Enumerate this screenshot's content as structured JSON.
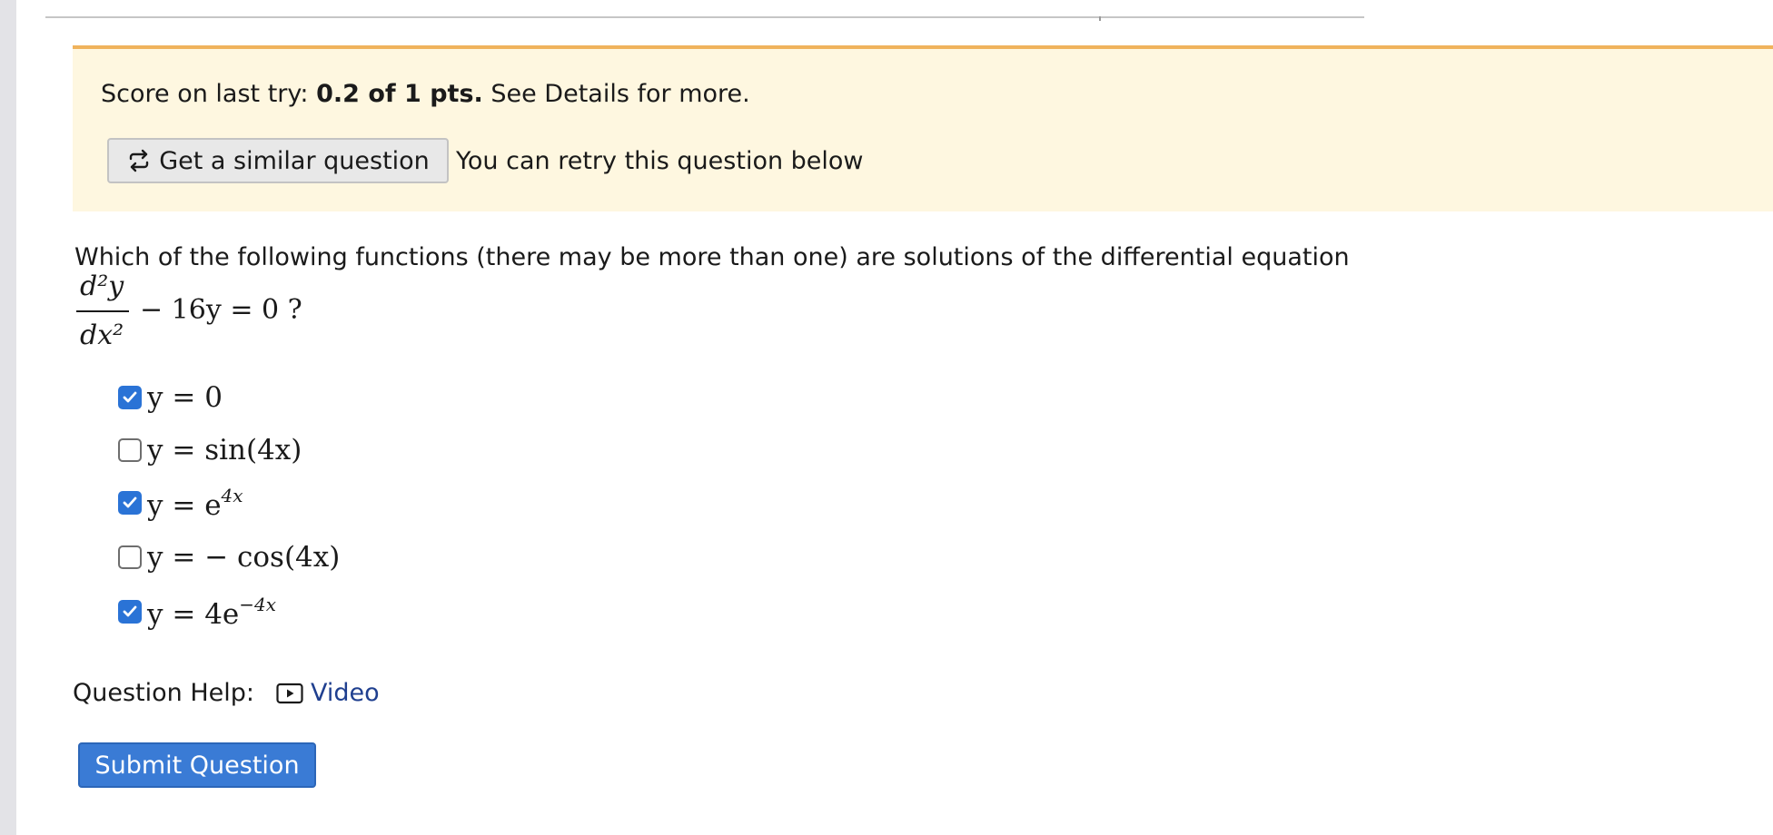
{
  "score_banner": {
    "prefix": "Score on last try: ",
    "score": "0.2 of 1 pts.",
    "suffix": " See Details for more.",
    "similar_button_label": "Get a similar question",
    "retry_text": "You can retry this question below"
  },
  "question": {
    "text": "Which of the following functions (there may be more than one) are solutions of the differential equation",
    "equation": {
      "numerator": "d²y",
      "denominator": "dx²",
      "rest": "− 16y = 0 ?"
    }
  },
  "choices": [
    {
      "label": "y = 0",
      "checked": true
    },
    {
      "label": "y = sin(4x)",
      "checked": false
    },
    {
      "label": "y = e^4x",
      "base": "y = e",
      "exponent": "4x",
      "checked": true
    },
    {
      "label": "y = − cos(4x)",
      "checked": false
    },
    {
      "label": "y = 4e^−4x",
      "base": "y = 4e",
      "exponent": "−4x",
      "checked": true
    }
  ],
  "help": {
    "label": "Question Help:",
    "video_label": "Video",
    "video_icon": "video-play-icon"
  },
  "submit_label": "Submit Question",
  "colors": {
    "banner_bg": "#fef7e0",
    "banner_border": "#f0b35c",
    "checkbox_checked": "#2a73d6",
    "submit_bg": "#3a7bd5",
    "link": "#1f3f8f"
  }
}
